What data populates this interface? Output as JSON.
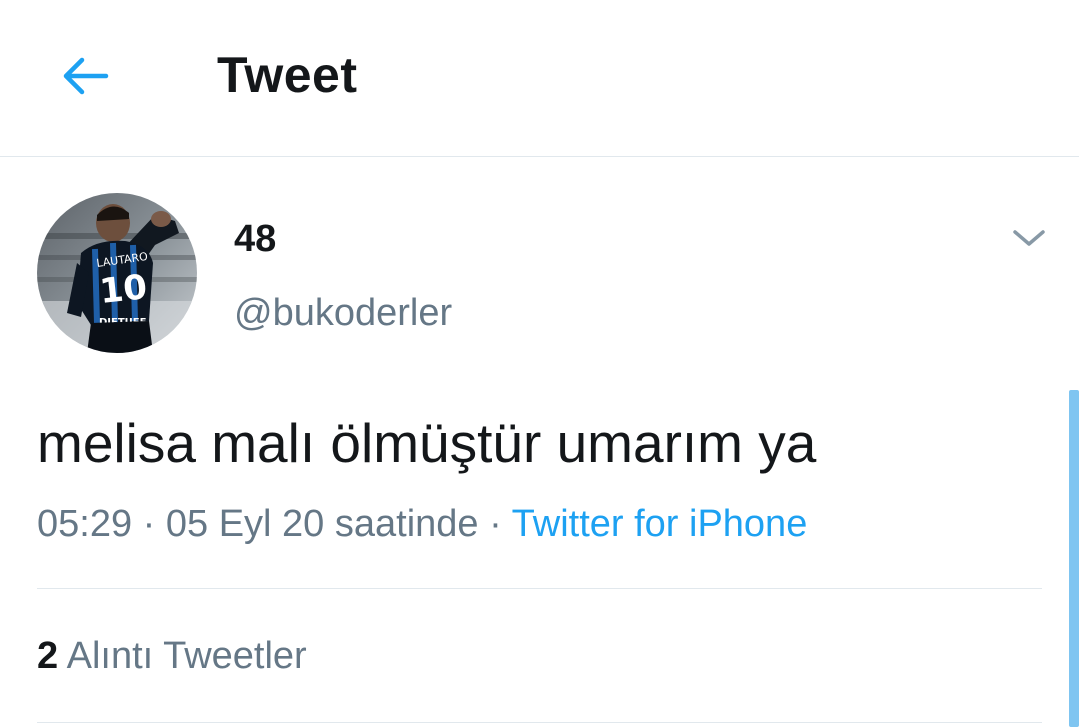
{
  "header": {
    "title": "Tweet",
    "back_icon": "arrow-left-icon"
  },
  "colors": {
    "accent": "#1da1f2",
    "text_primary": "#14171a",
    "text_secondary": "#657786",
    "divider": "#e1e8ed",
    "scrollbar": "#7fc5f1"
  },
  "author": {
    "display_name": "48",
    "handle": "@bukoderler",
    "avatar_jersey_name": "LAUTARO",
    "avatar_jersey_number": "10",
    "avatar_sponsor": "DIFTUEE"
  },
  "tweet": {
    "text": "melisa malı ölmüştür umarım ya",
    "time": "05:29",
    "separator": "·",
    "date": "05 Eyl 20 saatinde",
    "source": "Twitter for iPhone"
  },
  "stats": {
    "quote_count": "2",
    "quote_label": "Alıntı Tweetler"
  }
}
